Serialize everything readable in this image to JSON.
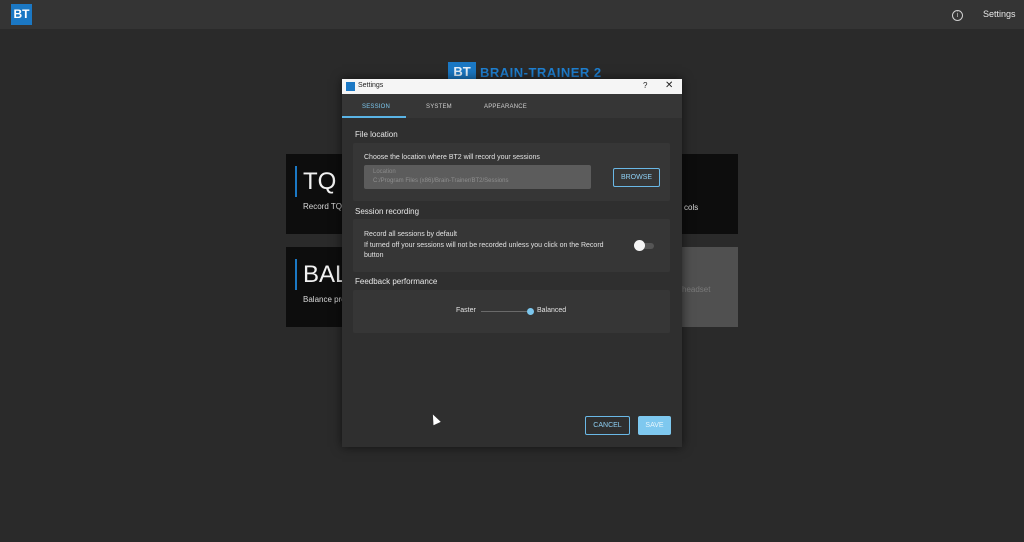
{
  "topbar": {
    "logo_text": "BT",
    "info_icon": "info-icon",
    "settings_label": "Settings"
  },
  "brand": {
    "mark": "BT",
    "name": "BRAIN-TRAINER 2"
  },
  "tiles": [
    {
      "big": "TQ",
      "sub": "Record TQ"
    },
    {
      "big": "BAL",
      "sub": "Balance pro"
    }
  ],
  "tile_right_text": "cols",
  "tile_grey_text": "headset",
  "dialog": {
    "title": "Settings",
    "help": "?",
    "close": "✕",
    "tabs": [
      {
        "label": "SESSION",
        "active": true
      },
      {
        "label": "SYSTEM",
        "active": false
      },
      {
        "label": "APPEARANCE",
        "active": false
      }
    ],
    "file_location": {
      "section_title": "File location",
      "description": "Choose the location where BT2 will record your sessions",
      "field_label": "Location",
      "field_value": "C:/Program Files (x86)/Brain-Trainer/BT2/Sessions",
      "browse_label": "BROWSE"
    },
    "session_recording": {
      "section_title": "Session recording",
      "line1": "Record all sessions by default",
      "line2": "If turned off your sessions will not be recorded unless you click on the Record",
      "line3": "button",
      "toggle_on": false
    },
    "feedback": {
      "section_title": "Feedback performance",
      "left_label": "Faster",
      "right_label": "Balanced",
      "value": 1.0
    },
    "cancel_label": "CANCEL",
    "save_label": "SAVE"
  },
  "colors": {
    "accent": "#5ab4e6",
    "brand": "#1b78c4",
    "background": "#2a2a2a"
  }
}
